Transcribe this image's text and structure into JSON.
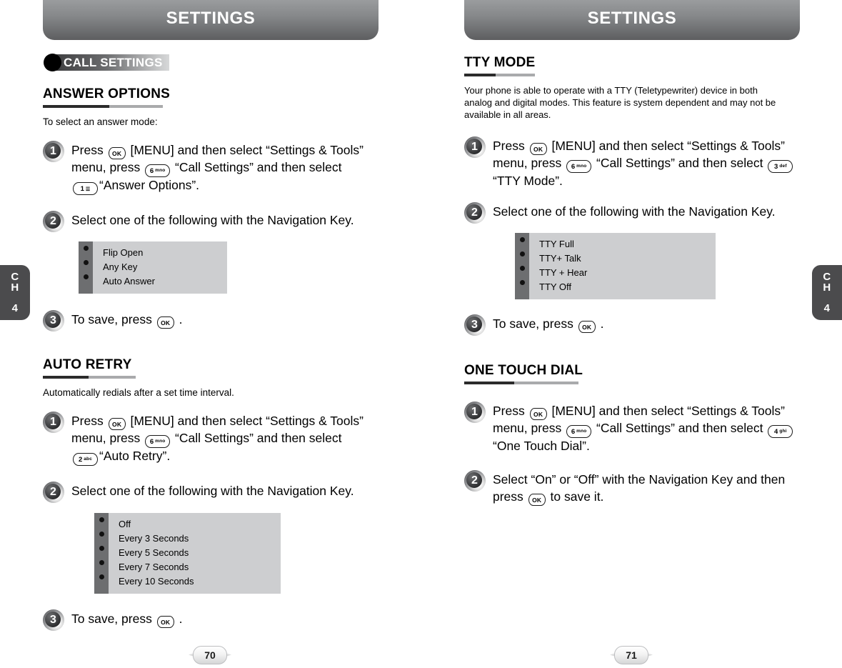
{
  "chapter_tab": {
    "letters_line1": "C",
    "letters_line2": "H",
    "number": "4"
  },
  "left_page": {
    "banner_title": "SETTINGS",
    "badge": {
      "label": "CALL SETTINGS"
    },
    "page_number": "70",
    "sections": [
      {
        "heading": "ANSWER OPTIONS",
        "intro": "To select an answer mode:",
        "steps": [
          {
            "number": "1",
            "text_parts": [
              "Press ",
              "[MENU] and then select “Settings & Tools” menu, press ",
              "“Call Settings” and then select ",
              "“Answer Options”."
            ],
            "keys": [
              {
                "type": "ok",
                "label": "OK"
              },
              {
                "type": "num",
                "digit": "6",
                "sub": "mno"
              },
              {
                "type": "num",
                "digit": "1",
                "sub": "☰"
              }
            ]
          },
          {
            "number": "2",
            "text": "Select one of the following with the Navigation Key."
          },
          {
            "number": "3",
            "text_before": "To save, press ",
            "text_after": " .",
            "key": {
              "type": "ok",
              "label": "OK"
            }
          }
        ],
        "options": [
          "Flip Open",
          "Any Key",
          "Auto Answer"
        ]
      },
      {
        "heading": "AUTO RETRY",
        "intro": "Automatically redials after a set time interval.",
        "steps": [
          {
            "number": "1",
            "text_parts": [
              "Press ",
              "[MENU] and then select “Settings & Tools” menu, press ",
              "“Call Settings” and then select ",
              "“Auto Retry”."
            ],
            "keys": [
              {
                "type": "ok",
                "label": "OK"
              },
              {
                "type": "num",
                "digit": "6",
                "sub": "mno"
              },
              {
                "type": "num",
                "digit": "2",
                "sub": "abc"
              }
            ]
          },
          {
            "number": "2",
            "text": "Select one of the following with the Navigation Key."
          },
          {
            "number": "3",
            "text_before": "To save, press ",
            "text_after": " .",
            "key": {
              "type": "ok",
              "label": "OK"
            }
          }
        ],
        "options": [
          "Off",
          "Every 3 Seconds",
          "Every 5 Seconds",
          "Every 7 Seconds",
          "Every 10 Seconds"
        ]
      }
    ]
  },
  "right_page": {
    "banner_title": "SETTINGS",
    "page_number": "71",
    "sections": [
      {
        "heading": "TTY MODE",
        "intro": "Your phone is able to operate with a TTY (Teletypewriter) device in both analog and digital modes. This feature is system dependent and may not be available in all areas.",
        "steps": [
          {
            "number": "1",
            "text_parts": [
              "Press ",
              "[MENU] and then select “Settings & Tools” menu, press ",
              "“Call Settings” and then select ",
              "“TTY Mode”."
            ],
            "keys": [
              {
                "type": "ok",
                "label": "OK"
              },
              {
                "type": "num",
                "digit": "6",
                "sub": "mno"
              },
              {
                "type": "num",
                "digit": "3",
                "sub": "def"
              }
            ]
          },
          {
            "number": "2",
            "text": "Select one of the following with the Navigation Key."
          },
          {
            "number": "3",
            "text_before": "To save, press ",
            "text_after": " .",
            "key": {
              "type": "ok",
              "label": "OK"
            }
          }
        ],
        "options": [
          "TTY Full",
          "TTY+ Talk",
          "TTY + Hear",
          "TTY Off"
        ]
      },
      {
        "heading": "ONE TOUCH DIAL",
        "steps": [
          {
            "number": "1",
            "text_parts": [
              "Press ",
              "[MENU] and then select “Settings & Tools” menu, press ",
              "“Call Settings” and then select ",
              "“One Touch Dial”."
            ],
            "keys": [
              {
                "type": "ok",
                "label": "OK"
              },
              {
                "type": "num",
                "digit": "6",
                "sub": "mno"
              },
              {
                "type": "num",
                "digit": "4",
                "sub": "ghi"
              }
            ]
          },
          {
            "number": "2",
            "text_before": "Select “On” or “Off” with the Navigation Key and then press ",
            "text_after": " to save it.",
            "key": {
              "type": "ok",
              "label": "OK"
            }
          }
        ]
      }
    ]
  },
  "colors": {
    "banner_top": "#9a9c9e",
    "banner_bottom": "#5d5e60",
    "tab_gray": "#4b4b4d",
    "optbox_bullet_col": "#6d6e70",
    "optbox_label_col": "#cdced0",
    "rule_dark": "#2b2b2b",
    "rule_light": "#a9aaac"
  }
}
